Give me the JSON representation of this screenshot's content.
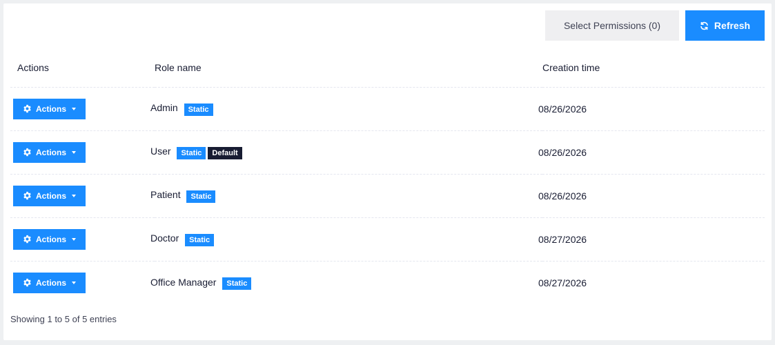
{
  "toolbar": {
    "select_permissions_label": "Select Permissions (0)",
    "refresh_label": "Refresh"
  },
  "table": {
    "headers": {
      "actions": "Actions",
      "role_name": "Role name",
      "creation_time": "Creation time"
    },
    "action_button_label": "Actions",
    "badges": {
      "static": "Static",
      "default": "Default"
    },
    "rows": [
      {
        "role": "Admin",
        "creation_time": "08/26/2026"
      },
      {
        "role": "User",
        "creation_time": "08/26/2026"
      },
      {
        "role": "Patient",
        "creation_time": "08/26/2026"
      },
      {
        "role": "Doctor",
        "creation_time": "08/27/2026"
      },
      {
        "role": "Office Manager",
        "creation_time": "08/27/2026"
      }
    ]
  },
  "footer": {
    "info": "Showing 1 to 5 of 5 entries"
  },
  "colors": {
    "primary": "#1a8cff",
    "dark_badge": "#181c32",
    "secondary_button": "#efeff1"
  },
  "icons": {
    "refresh": "refresh-icon",
    "gear": "gear-icon",
    "caret": "caret-down-icon"
  }
}
